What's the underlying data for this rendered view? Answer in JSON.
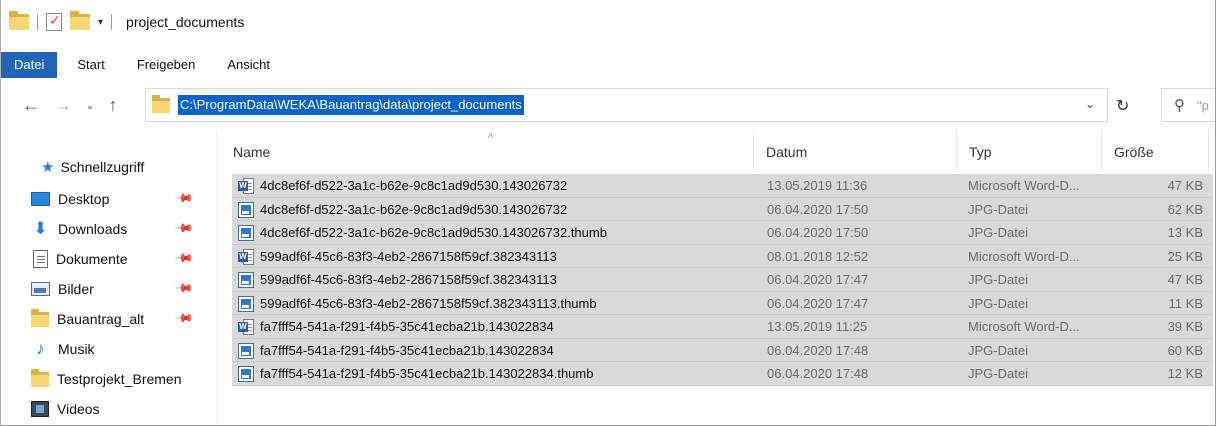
{
  "window": {
    "title": "project_documents"
  },
  "menu": [
    {
      "label": "Datei",
      "active": true
    },
    {
      "label": "Start",
      "active": false
    },
    {
      "label": "Freigeben",
      "active": false
    },
    {
      "label": "Ansicht",
      "active": false
    }
  ],
  "address": {
    "path": "C:\\ProgramData\\WEKA\\Bauantrag\\data\\project_documents"
  },
  "search": {
    "placeholder_visible": "\"p"
  },
  "nav": {
    "quick_access": "Schnellzugriff",
    "items": [
      {
        "label": "Desktop",
        "icon": "desktop-icon",
        "pinned": true
      },
      {
        "label": "Downloads",
        "icon": "download-arrow-icon",
        "pinned": true
      },
      {
        "label": "Dokumente",
        "icon": "documents-icon",
        "pinned": true
      },
      {
        "label": "Bilder",
        "icon": "pictures-icon",
        "pinned": true
      },
      {
        "label": "Bauantrag_alt",
        "icon": "folder-icon",
        "pinned": true
      },
      {
        "label": "Musik",
        "icon": "music-note-icon",
        "pinned": false
      },
      {
        "label": "Testprojekt_Bremen",
        "icon": "folder-icon",
        "pinned": false
      },
      {
        "label": "Videos",
        "icon": "video-icon",
        "pinned": false
      }
    ]
  },
  "columns": {
    "name": "Name",
    "date": "Datum",
    "type": "Typ",
    "size": "Größe"
  },
  "files": [
    {
      "name": "4dc8ef6f-d522-3a1c-b62e-9c8c1ad9d530.143026732",
      "date": "13.05.2019 11:36",
      "type": "Microsoft Word-D...",
      "size": "47 KB",
      "icon": "word"
    },
    {
      "name": "4dc8ef6f-d522-3a1c-b62e-9c8c1ad9d530.143026732",
      "date": "06.04.2020 17:50",
      "type": "JPG-Datei",
      "size": "62 KB",
      "icon": "jpg"
    },
    {
      "name": "4dc8ef6f-d522-3a1c-b62e-9c8c1ad9d530.143026732.thumb",
      "date": "06.04.2020 17:50",
      "type": "JPG-Datei",
      "size": "13 KB",
      "icon": "jpg"
    },
    {
      "name": "599adf6f-45c6-83f3-4eb2-2867158f59cf.382343113",
      "date": "08.01.2018 12:52",
      "type": "Microsoft Word-D...",
      "size": "25 KB",
      "icon": "word"
    },
    {
      "name": "599adf6f-45c6-83f3-4eb2-2867158f59cf.382343113",
      "date": "06.04.2020 17:47",
      "type": "JPG-Datei",
      "size": "47 KB",
      "icon": "jpg"
    },
    {
      "name": "599adf6f-45c6-83f3-4eb2-2867158f59cf.382343113.thumb",
      "date": "06.04.2020 17:47",
      "type": "JPG-Datei",
      "size": "11 KB",
      "icon": "jpg"
    },
    {
      "name": "fa7fff54-541a-f291-f4b5-35c41ecba21b.143022834",
      "date": "13.05.2019 11:25",
      "type": "Microsoft Word-D...",
      "size": "39 KB",
      "icon": "word"
    },
    {
      "name": "fa7fff54-541a-f291-f4b5-35c41ecba21b.143022834",
      "date": "06.04.2020 17:48",
      "type": "JPG-Datei",
      "size": "60 KB",
      "icon": "jpg"
    },
    {
      "name": "fa7fff54-541a-f291-f4b5-35c41ecba21b.143022834.thumb",
      "date": "06.04.2020 17:48",
      "type": "JPG-Datei",
      "size": "12 KB",
      "icon": "jpg"
    }
  ],
  "colors": {
    "accent": "#1f64b8",
    "selection": "#d9d9d9",
    "path_highlight": "#0a63c9"
  }
}
